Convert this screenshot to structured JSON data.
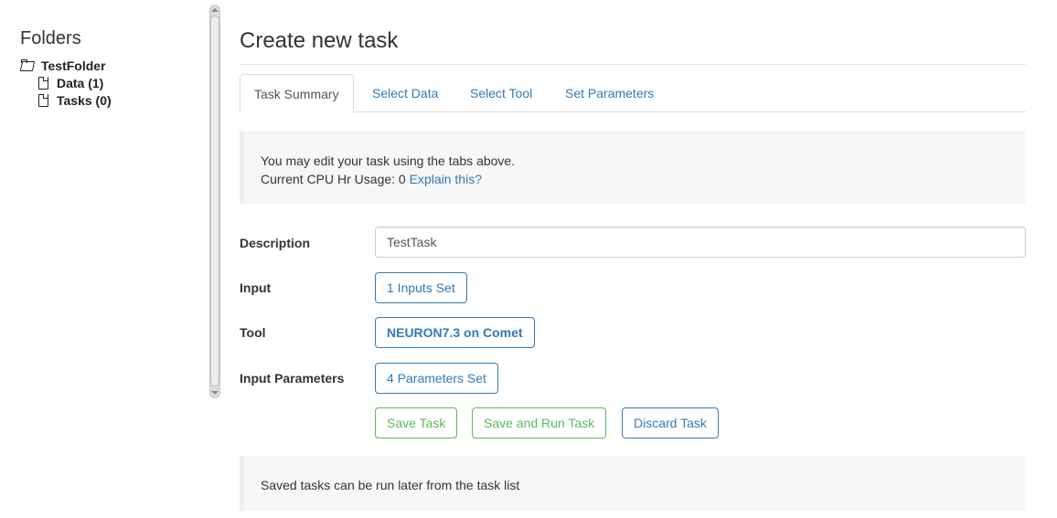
{
  "sidebar": {
    "title": "Folders",
    "root": {
      "label": "TestFolder",
      "icon": "folder-open-icon",
      "children": [
        {
          "label": "Data (1)",
          "icon": "file-icon"
        },
        {
          "label": "Tasks (0)",
          "icon": "file-icon"
        }
      ]
    }
  },
  "main": {
    "title": "Create new task",
    "tabs": [
      {
        "label": "Task Summary",
        "active": true
      },
      {
        "label": "Select Data",
        "active": false
      },
      {
        "label": "Select Tool",
        "active": false
      },
      {
        "label": "Set Parameters",
        "active": false
      }
    ],
    "info": {
      "line1": "You may edit your task using the tabs above.",
      "cpu_label": "Current CPU Hr Usage: 0",
      "explain_link": "Explain this?"
    },
    "form": {
      "description_label": "Description",
      "description_value": "TestTask",
      "input_label": "Input",
      "input_button": "1 Inputs Set",
      "tool_label": "Tool",
      "tool_button": "NEURON7.3 on Comet",
      "params_label": "Input Parameters",
      "params_button": "4 Parameters Set"
    },
    "actions": {
      "save": "Save Task",
      "save_run": "Save and Run Task",
      "discard": "Discard Task"
    },
    "footer_note": "Saved tasks can be run later from the task list"
  },
  "colors": {
    "link": "#337ab7",
    "success": "#5cb85c",
    "panel_bg": "#f7f7f7"
  }
}
